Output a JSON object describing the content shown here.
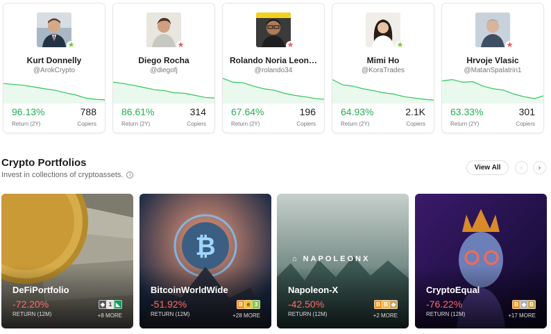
{
  "traders": [
    {
      "name": "Kurt Donnelly",
      "handle": "@ArokCrypto",
      "return_value": "96.13%",
      "return_label": "Return (2Y)",
      "copiers_value": "788",
      "copiers_label": "Copiers",
      "badge": "green-star",
      "sparkline": [
        0.35,
        0.38,
        0.42,
        0.48,
        0.55,
        0.6,
        0.7,
        0.78,
        0.9,
        0.95,
        0.97
      ]
    },
    {
      "name": "Diego Rocha",
      "handle": "@diegofj",
      "return_value": "86.61%",
      "return_label": "Return (2Y)",
      "copiers_value": "314",
      "copiers_label": "Copiers",
      "badge": "red-star",
      "sparkline": [
        0.3,
        0.35,
        0.42,
        0.5,
        0.58,
        0.62,
        0.7,
        0.72,
        0.8,
        0.88,
        0.9
      ]
    },
    {
      "name": "Rolando Noria Leon…",
      "handle": "@rolando34",
      "return_value": "67.64%",
      "return_label": "Return (2Y)",
      "copiers_value": "196",
      "copiers_label": "Copiers",
      "badge": "red-star",
      "sparkline": [
        0.15,
        0.3,
        0.32,
        0.45,
        0.55,
        0.6,
        0.72,
        0.8,
        0.85,
        0.92,
        0.95
      ]
    },
    {
      "name": "Mimi Ho",
      "handle": "@KoraTrades",
      "return_value": "64.93%",
      "return_label": "Return (2Y)",
      "copiers_value": "2.1K",
      "copiers_label": "Copiers",
      "badge": "green-star",
      "sparkline": [
        0.2,
        0.4,
        0.45,
        0.55,
        0.62,
        0.7,
        0.75,
        0.85,
        0.9,
        0.95,
        0.98
      ]
    },
    {
      "name": "Hrvoje Vlasic",
      "handle": "@MatanSpalatrin1",
      "return_value": "63.33%",
      "return_label": "Return (2Y)",
      "copiers_value": "301",
      "copiers_label": "Copiers",
      "badge": "red-star",
      "sparkline": [
        0.25,
        0.2,
        0.3,
        0.28,
        0.45,
        0.55,
        0.6,
        0.75,
        0.85,
        0.92,
        0.8
      ]
    }
  ],
  "section": {
    "title": "Crypto Portfolios",
    "subtitle": "Invest in collections of cryptoassets.",
    "view_all": "View All",
    "prev_icon": "chevron-left-icon",
    "next_icon": "chevron-right-icon"
  },
  "portfolios": [
    {
      "name": "DeFiPortfolio",
      "return_value": "-72.20%",
      "return_label": "RETURN (12M)",
      "more": "+8 MORE",
      "theme": "coins-dollars"
    },
    {
      "name": "BitcoinWorldWide",
      "return_value": "-51.92%",
      "return_label": "RETURN (12M)",
      "more": "+28 MORE",
      "theme": "bitcoin-planet"
    },
    {
      "name": "Napoleon-X",
      "return_value": "-42.50%",
      "return_label": "RETURN (12M)",
      "more": "+2 MORE",
      "theme": "misty-forest",
      "logo_text": "NAPOLEONX"
    },
    {
      "name": "CryptoEqual",
      "return_value": "-76.22%",
      "return_label": "RETURN (12M)",
      "more": "+17 MORE",
      "theme": "crowned-statue"
    }
  ],
  "colors": {
    "positive": "#1eb34e",
    "negative": "#ff6b6b",
    "sparkline_line": "#2dc55a",
    "green_star": "#7ac142",
    "red_star": "#e55b5b"
  }
}
